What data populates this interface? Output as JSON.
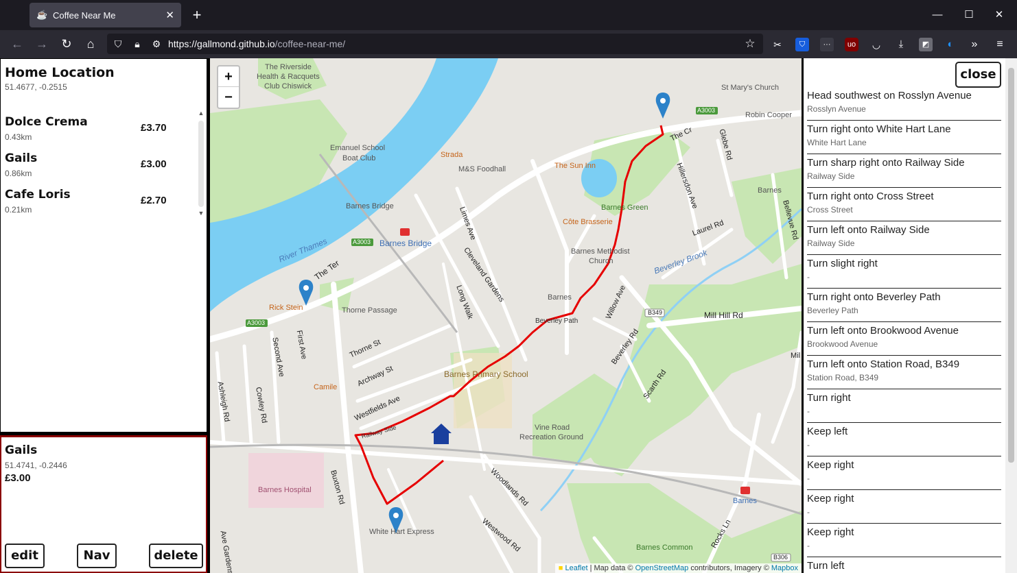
{
  "browser": {
    "tab_title": "Coffee Near Me",
    "tab_favicon": "coffee-cup-icon",
    "url_host": "https://gallmond.github.io",
    "url_path": "/coffee-near-me/"
  },
  "home": {
    "title": "Home Location",
    "coords": "51.4677, -0.2515"
  },
  "shops": [
    {
      "name": "Dolce Crema",
      "distance": "0.43km",
      "price": "£3.70"
    },
    {
      "name": "Gails",
      "distance": "0.86km",
      "price": "£3.00"
    },
    {
      "name": "Cafe Loris",
      "distance": "0.21km",
      "price": "£2.70"
    }
  ],
  "selected": {
    "name": "Gails",
    "coords": "51.4741, -0.2446",
    "price": "£3.00",
    "edit_label": "edit",
    "nav_label": "Nav",
    "delete_label": "delete"
  },
  "map": {
    "zoom_in": "+",
    "zoom_out": "−",
    "attribution": {
      "leaflet": "Leaflet",
      "text1": " | Map data © ",
      "osm": "OpenStreetMap",
      "text2": " contributors, Imagery © ",
      "mapbox": "Mapbox"
    },
    "route_color": "#e60000",
    "labels": {
      "riverside": "The Riverside",
      "health": "Health & Racquets",
      "club_chiswick": "Club Chiswick",
      "emanuel1": "Emanuel School",
      "emanuel2": "Boat Club",
      "barnes_bridge": "Barnes Bridge",
      "barnes_bridge_stn": "Barnes Bridge",
      "river_thames": "River Thames",
      "the_ter": "The Ter",
      "rick_stein": "Rick Stein",
      "thorne_passage": "Thorne Passage",
      "strada": "Strada",
      "ms_foodhall": "M&S Foodhall",
      "sun_inn": "The Sun Inn",
      "st_marys": "St Mary's Church",
      "robin_cooper": "Robin Cooper",
      "the_cr": "The Cr",
      "barnes_green": "Barnes Green",
      "cote": "Côte Brasserie",
      "methodist1": "Barnes Methodist",
      "methodist2": "Church",
      "barnes": "Barnes",
      "barnes2": "Barnes",
      "beverley_path": "Beverley Path",
      "beverley_brook": "Beverley Brook",
      "mill_hill": "Mill Hill Rd",
      "laurel": "Laurel Rd",
      "hillersdon": "Hillersdon Ave",
      "glebe": "Glebe Rd",
      "bellevue": "Bellevue Rd",
      "willow": "Willow Ave",
      "beverley_rd": "Beverley Rd",
      "b349": "B349",
      "a3003a": "A3003",
      "a3003b": "A3003",
      "a3003c": "A3003",
      "limes": "Limes Ave",
      "cleveland": "Cleveland Gardens",
      "long_walk": "Long Walk",
      "thorne_st": "Thorne St",
      "archway": "Archway St",
      "westfields": "Westfields Ave",
      "camile": "Camile",
      "primary": "Barnes Primary School",
      "railway_side": "Railway Side",
      "vine_road1": "Vine Road",
      "vine_road2": "Recreation Ground",
      "scarth": "Scarth Rd",
      "first_ave": "First Ave",
      "second_ave": "Second Ave",
      "cowley": "Cowley Rd",
      "ashleigh": "Ashleigh Rd",
      "buxton": "Buxton Rd",
      "hospital": "Barnes Hospital",
      "white_hart": "White Hart Express",
      "woodlands": "Woodlands Rd",
      "westwood": "Westwood Rd",
      "barnes_common": "Barnes Common",
      "rocks": "Rocks Ln",
      "barnes_stn": "Barnes",
      "b306": "B306",
      "mil": "Mil",
      "ave_gardens": "Ave Gardens"
    }
  },
  "directions": {
    "close_label": "close",
    "steps": [
      {
        "instruction": "Head southwest on Rosslyn Avenue",
        "road": "Rosslyn Avenue"
      },
      {
        "instruction": "Turn right onto White Hart Lane",
        "road": "White Hart Lane"
      },
      {
        "instruction": "Turn sharp right onto Railway Side",
        "road": "Railway Side"
      },
      {
        "instruction": "Turn right onto Cross Street",
        "road": "Cross Street"
      },
      {
        "instruction": "Turn left onto Railway Side",
        "road": "Railway Side"
      },
      {
        "instruction": "Turn slight right",
        "road": "-"
      },
      {
        "instruction": "Turn right onto Beverley Path",
        "road": "Beverley Path"
      },
      {
        "instruction": "Turn left onto Brookwood Avenue",
        "road": "Brookwood Avenue"
      },
      {
        "instruction": "Turn left onto Station Road, B349",
        "road": "Station Road, B349"
      },
      {
        "instruction": "Turn right",
        "road": "-"
      },
      {
        "instruction": "Keep left",
        "road": "-"
      },
      {
        "instruction": "Keep right",
        "road": "-"
      },
      {
        "instruction": "Keep right",
        "road": "-"
      },
      {
        "instruction": "Keep right",
        "road": "-"
      },
      {
        "instruction": "Turn left",
        "road": ""
      }
    ]
  }
}
